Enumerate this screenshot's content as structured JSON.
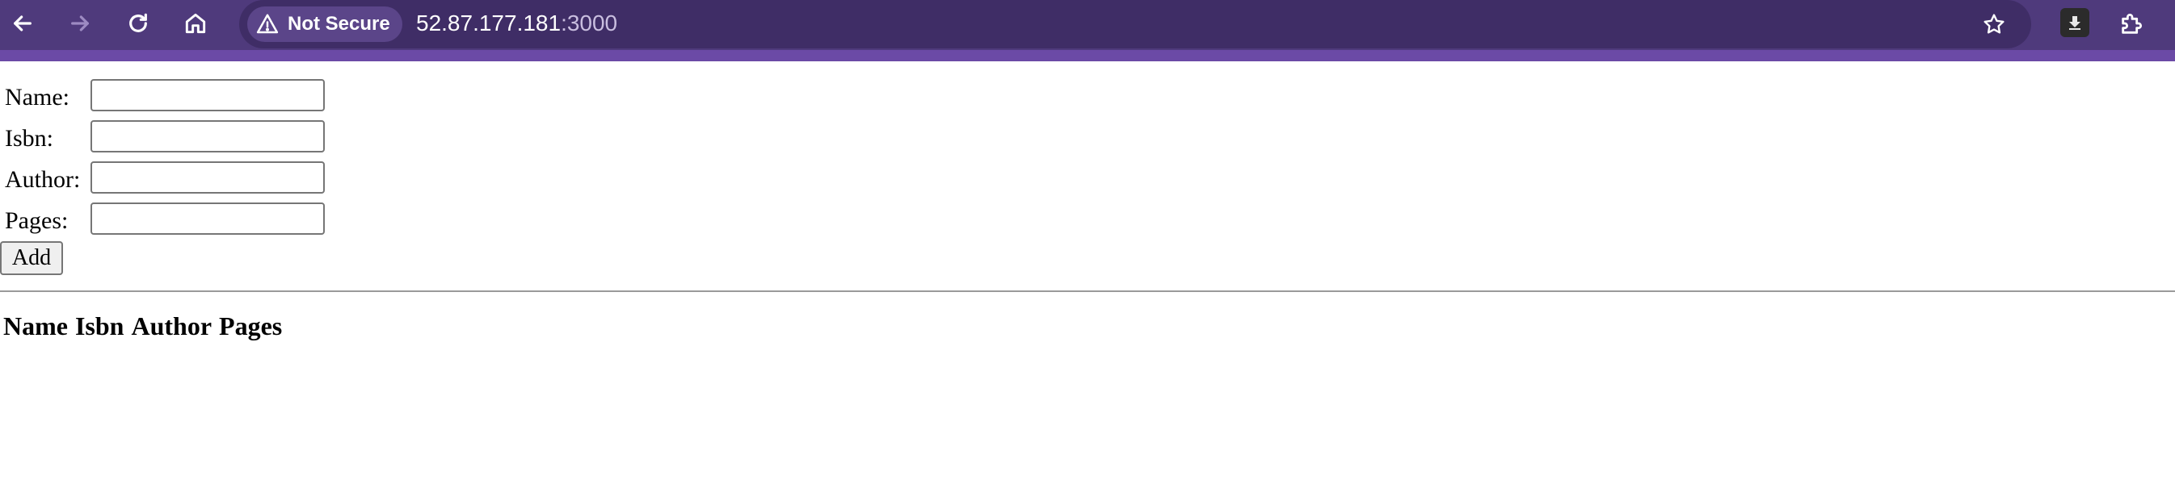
{
  "browser": {
    "security_label": "Not Secure",
    "url_host": "52.87.177.181",
    "url_port": ":3000",
    "icons": [
      "back-arrow-icon",
      "forward-arrow-icon",
      "reload-icon",
      "home-icon",
      "warning-icon",
      "bookmark-star-icon",
      "download-icon",
      "extensions-icon"
    ],
    "chrome_color": "#4f3a7c",
    "accent_color": "#6b4aa6"
  },
  "form": {
    "fields": [
      {
        "label": "Name:",
        "value": ""
      },
      {
        "label": "Isbn:",
        "value": ""
      },
      {
        "label": "Author:",
        "value": ""
      },
      {
        "label": "Pages:",
        "value": ""
      }
    ],
    "add_label": "Add"
  },
  "table": {
    "columns": [
      "Name",
      "Isbn",
      "Author",
      "Pages"
    ],
    "rows": []
  }
}
